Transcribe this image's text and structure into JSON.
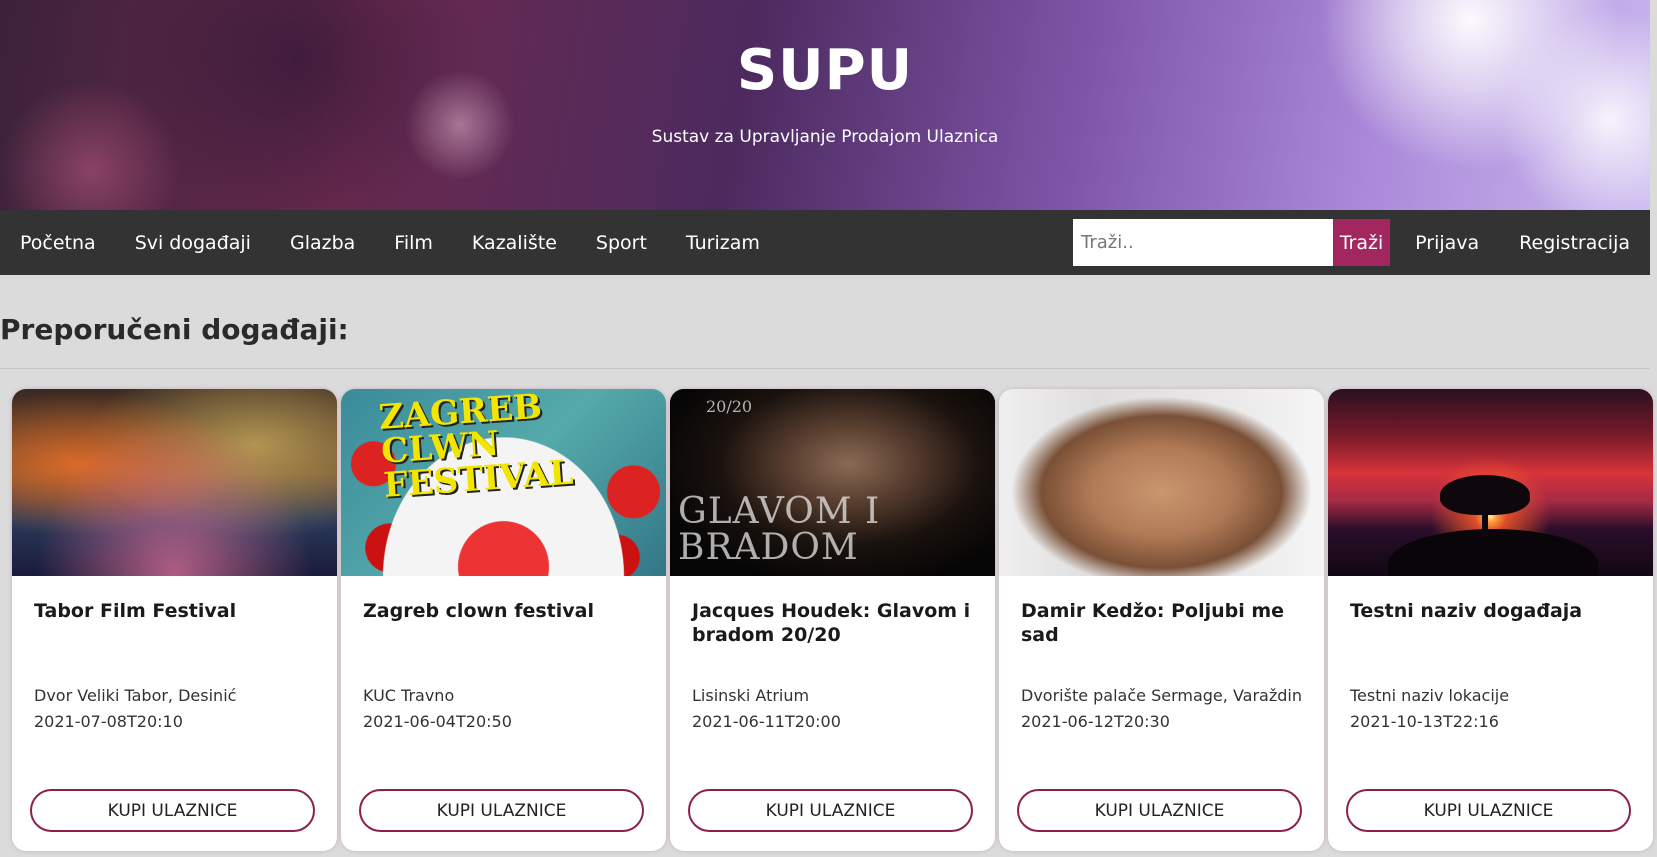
{
  "header": {
    "title": "SUPU",
    "subtitle": "Sustav za Upravljanje Prodajom Ulaznica"
  },
  "nav": {
    "items": [
      "Početna",
      "Svi događaji",
      "Glazba",
      "Film",
      "Kazalište",
      "Sport",
      "Turizam"
    ],
    "search_placeholder": "Traži..",
    "search_button": "Traži",
    "login": "Prijava",
    "register": "Registracija"
  },
  "main": {
    "section_title": "Preporučeni događaji:",
    "events": [
      {
        "title": "Tabor Film Festival",
        "location": "Dvor Veliki Tabor, Desinić",
        "datetime": "2021-07-08T20:10",
        "button": "KUPI ULAZNICE"
      },
      {
        "title": "Zagreb clown festival",
        "location": "KUC Travno",
        "datetime": "2021-06-04T20:50",
        "button": "KUPI ULAZNICE"
      },
      {
        "title": "Jacques Houdek: Glavom i bradom 20/20",
        "location": "Lisinski Atrium",
        "datetime": "2021-06-11T20:00",
        "button": "KUPI ULAZNICE"
      },
      {
        "title": "Damir Kedžo: Poljubi me sad",
        "location": "Dvorište palače Sermage, Varaždin",
        "datetime": "2021-06-12T20:30",
        "button": "KUPI ULAZNICE"
      },
      {
        "title": "Testni naziv događaja",
        "location": "Testni naziv lokacije",
        "datetime": "2021-10-13T22:16",
        "button": "KUPI ULAZNICE"
      }
    ],
    "image_text": {
      "poster2": "ZAGREB CLWN FESTIVAL",
      "poster3_badge": "20/20",
      "poster3": "GLAVOM I BRADOM"
    }
  },
  "colors": {
    "accent": "#a2275f",
    "navbar": "#333333",
    "page_bg": "#dcdbdc"
  }
}
